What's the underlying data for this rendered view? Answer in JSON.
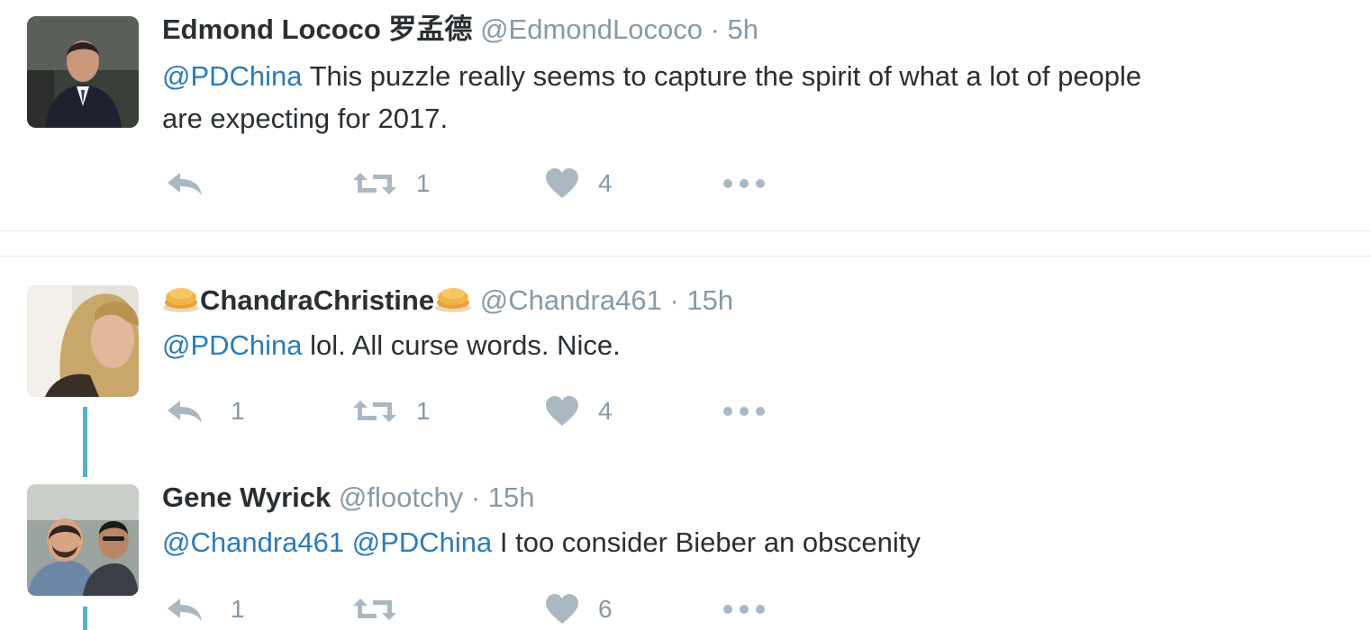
{
  "tweets": [
    {
      "name": "Edmond Lococo 罗孟德",
      "handle": "@EdmondLococo",
      "separator": "·",
      "time": "5h",
      "mentions": [
        "@PDChina"
      ],
      "text_line1": " This puzzle really seems to capture the spirit of what a lot of people",
      "text_line2": "are expecting for 2017.",
      "reply_count": "",
      "retweet_count": "1",
      "like_count": "4"
    },
    {
      "name": "ChandraChristine",
      "handle": "@Chandra461",
      "separator": "·",
      "time": "15h",
      "mentions": [
        "@PDChina"
      ],
      "text_line1": " lol. All curse words. Nice.",
      "reply_count": "1",
      "retweet_count": "1",
      "like_count": "4",
      "name_emoji": "pancakes-emoji"
    },
    {
      "name": "Gene Wyrick",
      "handle": "@flootchy",
      "separator": "·",
      "time": "15h",
      "mentions": [
        "@Chandra461",
        "@PDChina"
      ],
      "text_line1": " I too consider Bieber an obscenity",
      "reply_count": "1",
      "retweet_count": "",
      "like_count": "6"
    }
  ],
  "colors": {
    "link": "#2b7bb9",
    "muted": "#8899a6",
    "icon": "#aab8c2",
    "thread_line": "#4ab3d4"
  },
  "icons": [
    "reply-icon",
    "retweet-icon",
    "like-icon",
    "more-icon"
  ]
}
